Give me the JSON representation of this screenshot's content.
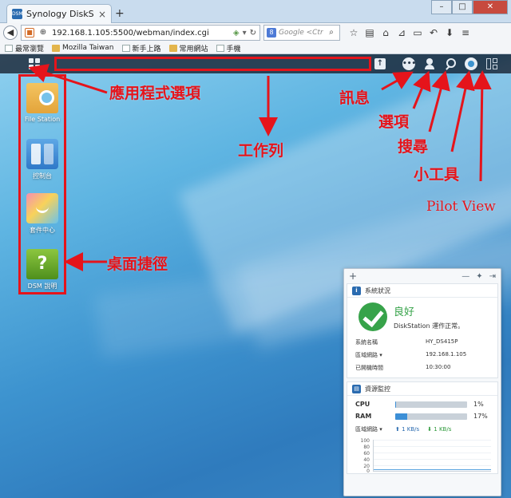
{
  "browser": {
    "tab_title": "Synology DiskStation - H...",
    "tab_favicon": "DSM",
    "new_tab": "+",
    "url": "192.168.1.105:5500/webman/index.cgi",
    "search_placeholder": "Google <Ctrl+K>",
    "search_engine_icon": "8",
    "bookmarks": [
      "最常瀏覽",
      "Mozilla Taiwan",
      "新手上路",
      "常用網站",
      "手機"
    ]
  },
  "annotations": {
    "app_menu": "應用程式選項",
    "taskbar": "工作列",
    "messages": "訊息",
    "options": "選項",
    "search": "搜尋",
    "widgets": "小工具",
    "pilot_view": "Pilot View",
    "desktop_shortcuts": "桌面捷徑"
  },
  "desktop": {
    "shortcuts": [
      {
        "label": "File Station",
        "icon": "file-station-icon"
      },
      {
        "label": "控制台",
        "icon": "control-panel-icon"
      },
      {
        "label": "套件中心",
        "icon": "package-center-icon"
      },
      {
        "label": "DSM 說明",
        "icon": "dsm-help-icon"
      }
    ],
    "help_glyph": "?"
  },
  "widgets": {
    "add_label": "+",
    "system_status": {
      "title": "系統狀況",
      "status": "良好",
      "message": "DiskStation 運作正常。",
      "rows": [
        {
          "key": "系統名稱",
          "value": "HY_DS415P"
        },
        {
          "key": "區域網路 ▾",
          "value": "192.168.1.105"
        },
        {
          "key": "已開機時間",
          "value": "10:30:00"
        }
      ]
    },
    "resource_monitor": {
      "title": "資源監控",
      "cpu_label": "CPU",
      "cpu_value": 0.01,
      "cpu_text": "1%",
      "ram_label": "RAM",
      "ram_value": 0.17,
      "ram_text": "17%",
      "lan_label": "區域網路 ▾",
      "upload": "1 KB/s",
      "download": "1 KB/s",
      "chart_ticks": [
        "100",
        "80",
        "60",
        "40",
        "20",
        "0"
      ]
    }
  }
}
